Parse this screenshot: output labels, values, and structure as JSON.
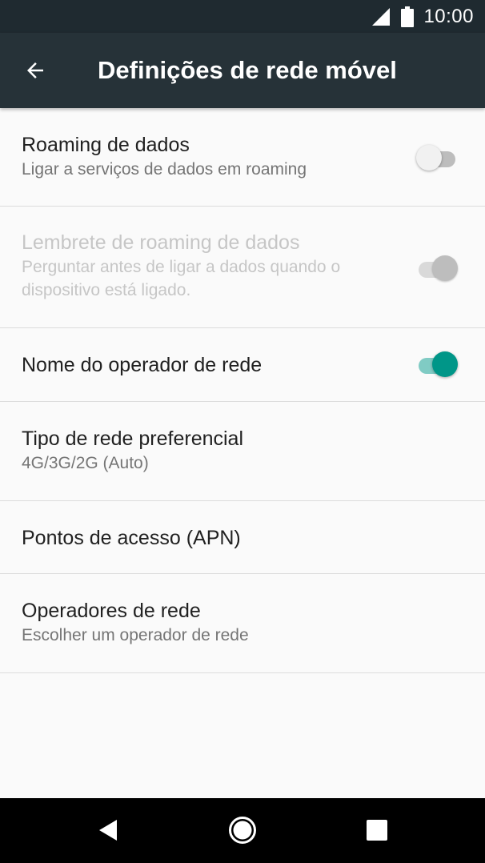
{
  "status_bar": {
    "time": "10:00",
    "icons": [
      "cellular-signal-icon",
      "battery-icon"
    ]
  },
  "app_bar": {
    "title": "Definições de rede móvel",
    "back_icon": "arrow-back-icon"
  },
  "settings": {
    "items": [
      {
        "title": "Roaming de dados",
        "summary": "Ligar a serviços de dados em roaming",
        "switch": "off",
        "enabled": true
      },
      {
        "title": "Lembrete de roaming de dados",
        "summary": "Perguntar antes de ligar a dados quando o dispositivo está ligado.",
        "switch": "on",
        "enabled": false
      },
      {
        "title": "Nome do operador de rede",
        "summary": "",
        "switch": "on",
        "enabled": true
      },
      {
        "title": "Tipo de rede preferencial",
        "summary": "4G/3G/2G (Auto)",
        "enabled": true
      },
      {
        "title": "Pontos de acesso (APN)",
        "summary": "",
        "enabled": true
      },
      {
        "title": "Operadores de rede",
        "summary": "Escolher um operador de rede",
        "enabled": true
      }
    ]
  },
  "nav_bar": {
    "icons": [
      "nav-back-icon",
      "nav-home-icon",
      "nav-recents-icon"
    ]
  },
  "colors": {
    "status_bar": "#1f2a30",
    "app_bar": "#263238",
    "accent": "#009688",
    "background": "#fafafa"
  }
}
